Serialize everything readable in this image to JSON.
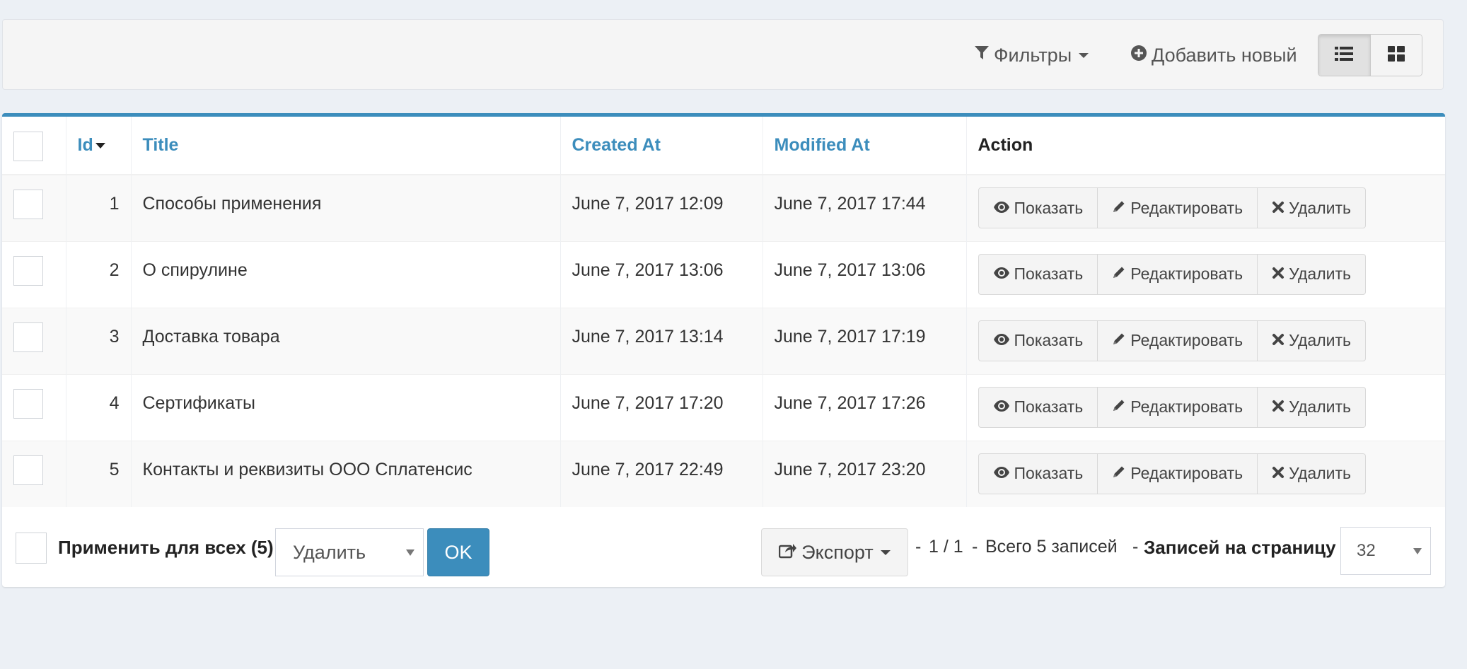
{
  "toolbar": {
    "filters_label": "Фильтры",
    "add_new_label": "Добавить новый"
  },
  "table": {
    "columns": [
      "Id",
      "Title",
      "Created At",
      "Modified At",
      "Action"
    ],
    "rows": [
      {
        "id": "1",
        "title": "Способы применения",
        "created": "June 7, 2017 12:09",
        "modified": "June 7, 2017 17:44"
      },
      {
        "id": "2",
        "title": "О спирулине",
        "created": "June 7, 2017 13:06",
        "modified": "June 7, 2017 13:06"
      },
      {
        "id": "3",
        "title": "Доставка товара",
        "created": "June 7, 2017 13:14",
        "modified": "June 7, 2017 17:19"
      },
      {
        "id": "4",
        "title": "Сертификаты",
        "created": "June 7, 2017 17:20",
        "modified": "June 7, 2017 17:26"
      },
      {
        "id": "5",
        "title": "Контакты и реквизиты ООО Сплатенсис",
        "created": "June 7, 2017 22:49",
        "modified": "June 7, 2017 23:20"
      }
    ],
    "actions": {
      "show": "Показать",
      "edit": "Редактировать",
      "delete": "Удалить"
    }
  },
  "footer": {
    "apply_all_label": "Применить для всех (5)",
    "batch_action_value": "Удалить",
    "ok_label": "OK",
    "export_label": "Экспорт",
    "pager_separator": "-",
    "page_info": "1 / 1",
    "total_info": "Всего 5 записей",
    "per_page_label": "Записей на страницу",
    "per_page_value": "32"
  },
  "colors": {
    "accent": "#3c8dbc",
    "background": "#ecf0f5"
  }
}
